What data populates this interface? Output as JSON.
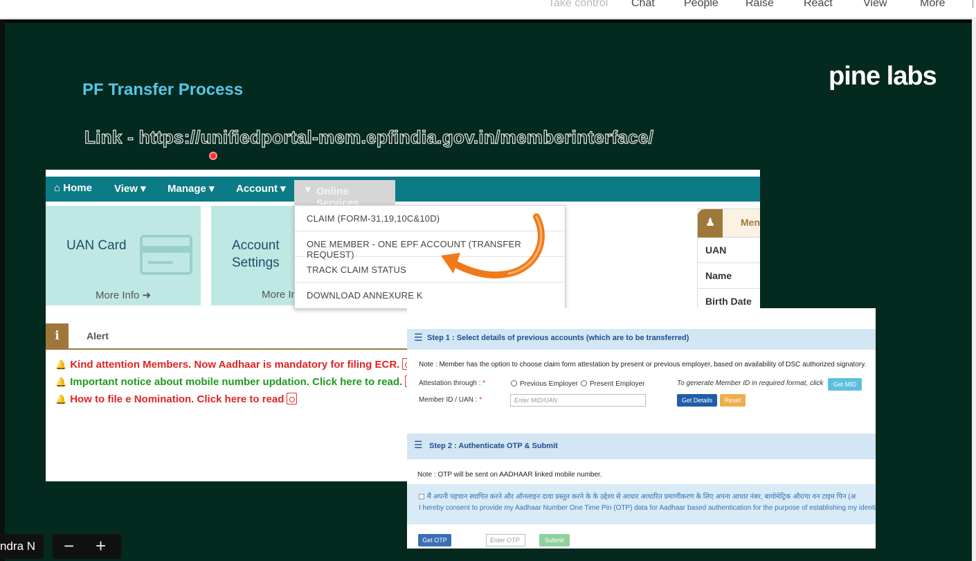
{
  "topbar": {
    "items": [
      "Take control",
      "Chat",
      "People",
      "Raise",
      "React",
      "View",
      "More"
    ]
  },
  "slide": {
    "title": "PF Transfer Process",
    "logo": "pine labs",
    "link_text": "Link - https://unifiedportal-mem.epfindia.gov.in/memberinterface/"
  },
  "portal": {
    "nav": {
      "home": "Home",
      "view": "View",
      "manage": "Manage",
      "account": "Account",
      "online_services": "Online Services"
    },
    "cards": [
      {
        "title": "UAN Card",
        "more": "More Info"
      },
      {
        "title_line1": "Account",
        "title_line2": "Settings",
        "more": "More In"
      }
    ],
    "dropdown": [
      "CLAIM (FORM-31,19,10C&10D)",
      "ONE MEMBER - ONE EPF ACCOUNT (TRANSFER REQUEST)",
      "TRACK CLAIM STATUS",
      "DOWNLOAD ANNEXURE K"
    ],
    "member": {
      "header": "Men",
      "rows": [
        "UAN",
        "Name",
        "Birth Date"
      ]
    },
    "alert": {
      "title": "Alert",
      "lines": [
        {
          "text": "Kind attention Members. Now Aadhaar is mandatory for filing ECR.",
          "color": "#e02424"
        },
        {
          "text": "Important notice about mobile number updation. Click here to read.",
          "color": "#1e9a1e"
        },
        {
          "text": "How to file e Nomination. Click here to read",
          "color": "#e02424"
        }
      ]
    }
  },
  "steps": {
    "step1": {
      "title": "Step 1 : Select details of previous accounts (which are to be transferred)",
      "note": "Note : Member has the option to choose claim form attestation by present or previous employer, based on availability of DSC authorized signatory.",
      "attestation_label": "Attestation through :",
      "required_mark": "*",
      "option_prev": "Previous Employer",
      "option_present": "Present Employer",
      "generate_hint": "To generate Member ID in required format, click",
      "get_mid": "Get MID",
      "member_label": "Member ID / UAN :",
      "member_placeholder": "Enter MID/UAN",
      "get_details": "Get Details",
      "reset": "Reset"
    },
    "step2": {
      "title": "Step 2 : Authenticate OTP & Submit",
      "note": "Note : OTP will be sent on AADHAAR linked mobile number.",
      "consent_hindi": "मैं अपनी पहचान स्थापित करने और ऑनलाइन दावा प्रस्तुत करने के के उद्देश्य से आधार आधारित प्रमाणीकरण के लिए अपना आधार नंबर, बायोमेट्रिक और/या वन टाइम पिन (अ",
      "consent_en": "I hereby consent to provide my Aadhaar Number One Time Pin (OTP) data for Aadhaar based authentication for the purpose of establishing my identity fo",
      "get_otp": "Get OTP",
      "otp_placeholder": "Enter OTP",
      "submit": "Submit"
    }
  },
  "bottom": {
    "name_tag": "ndra N",
    "zoom_out": "−",
    "zoom_in": "+"
  },
  "colors": {
    "slide_bg": "#04291f",
    "title": "#56c6e6",
    "navbar": "#0b7b86",
    "alert_accent": "#a0773a",
    "arrow": "#f07a1a"
  }
}
